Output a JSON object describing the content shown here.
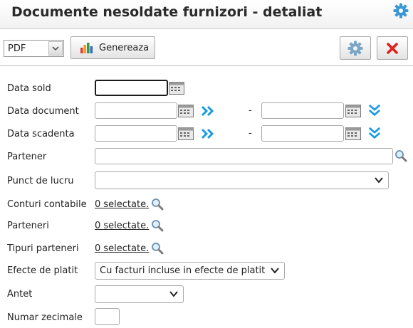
{
  "header": {
    "title": "Documente nesoldate furnizori - detaliat",
    "settings_icon": "gear-icon"
  },
  "toolbar": {
    "format": {
      "selected": "PDF"
    },
    "generate_label": "Genereaza",
    "generate_icon": "bar-chart-icon",
    "settings_icon": "gear-icon",
    "close_icon": "close-icon"
  },
  "form": {
    "data_sold": {
      "label": "Data sold",
      "value": ""
    },
    "data_document": {
      "label": "Data document",
      "from": "",
      "to": "",
      "separator": "-"
    },
    "data_scadenta": {
      "label": "Data scadenta",
      "from": "",
      "to": "",
      "separator": "-"
    },
    "partener": {
      "label": "Partener",
      "value": ""
    },
    "punct_de_lucru": {
      "label": "Punct de lucru",
      "selected": ""
    },
    "conturi_contabile": {
      "label": "Conturi contabile",
      "link": "0 selectate."
    },
    "parteneri": {
      "label": "Parteneri",
      "link": "0 selectate."
    },
    "tipuri_parteneri": {
      "label": "Tipuri parteneri",
      "link": "0 selectate."
    },
    "efecte_de_platit": {
      "label": "Efecte de platit",
      "selected": "Cu facturi incluse in efecte de platit"
    },
    "antet": {
      "label": "Antet",
      "selected": ""
    },
    "numar_zecimale": {
      "label": "Numar zecimale",
      "value": ""
    }
  },
  "colors": {
    "accent_blue": "#1a9be0",
    "close_red": "#e02020",
    "gear_blue": "#2a8fd0"
  }
}
